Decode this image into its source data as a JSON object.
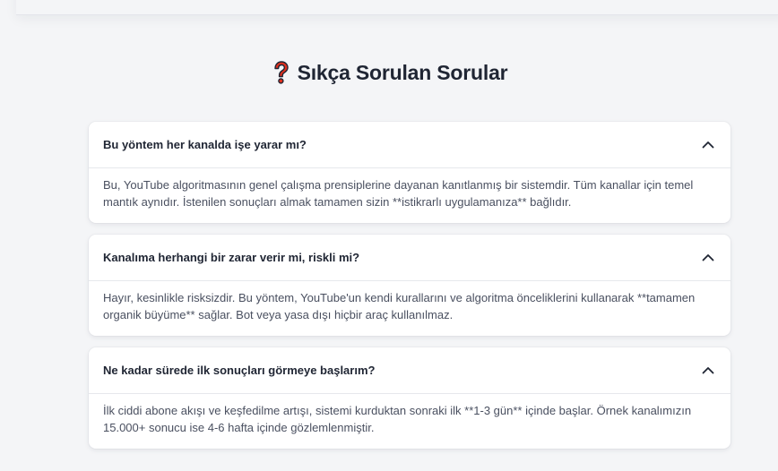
{
  "section": {
    "title": "Sıkça Sorulan Sorular",
    "title_icon": "red-question-mark-icon"
  },
  "faq": [
    {
      "question": "Bu yöntem her kanalda işe yarar mı?",
      "answer": "Bu, YouTube algoritmasının genel çalışma prensiplerine dayanan kanıtlanmış bir sistemdir. Tüm kanallar için temel mantık aynıdır. İstenilen sonuçları almak tamamen sizin **istikrarlı uygulamanıza** bağlıdır.",
      "expanded_icon": "chevron-up-icon"
    },
    {
      "question": "Kanalıma herhangi bir zarar verir mi, riskli mi?",
      "answer": "Hayır, kesinlikle risksizdir. Bu yöntem, YouTube'un kendi kurallarını ve algoritma önceliklerini kullanarak **tamamen organik büyüme** sağlar. Bot veya yasa dışı hiçbir araç kullanılmaz.",
      "expanded_icon": "chevron-up-icon"
    },
    {
      "question": "Ne kadar sürede ilk sonuçları görmeye başlarım?",
      "answer": "İlk ciddi abone akışı ve keşfedilme artışı, sistemi kurduktan sonraki ilk **1-3 gün** içinde başlar. Örnek kanalımızın 15.000+ sonucu ise 4-6 hafta içinde gözlemlenmiştir.",
      "expanded_icon": "chevron-up-icon"
    }
  ],
  "colors": {
    "background": "#f4f5f7",
    "card": "#ffffff",
    "heading": "#1f2533",
    "body_text": "#4a5060",
    "icon_red": "#e0301e"
  }
}
